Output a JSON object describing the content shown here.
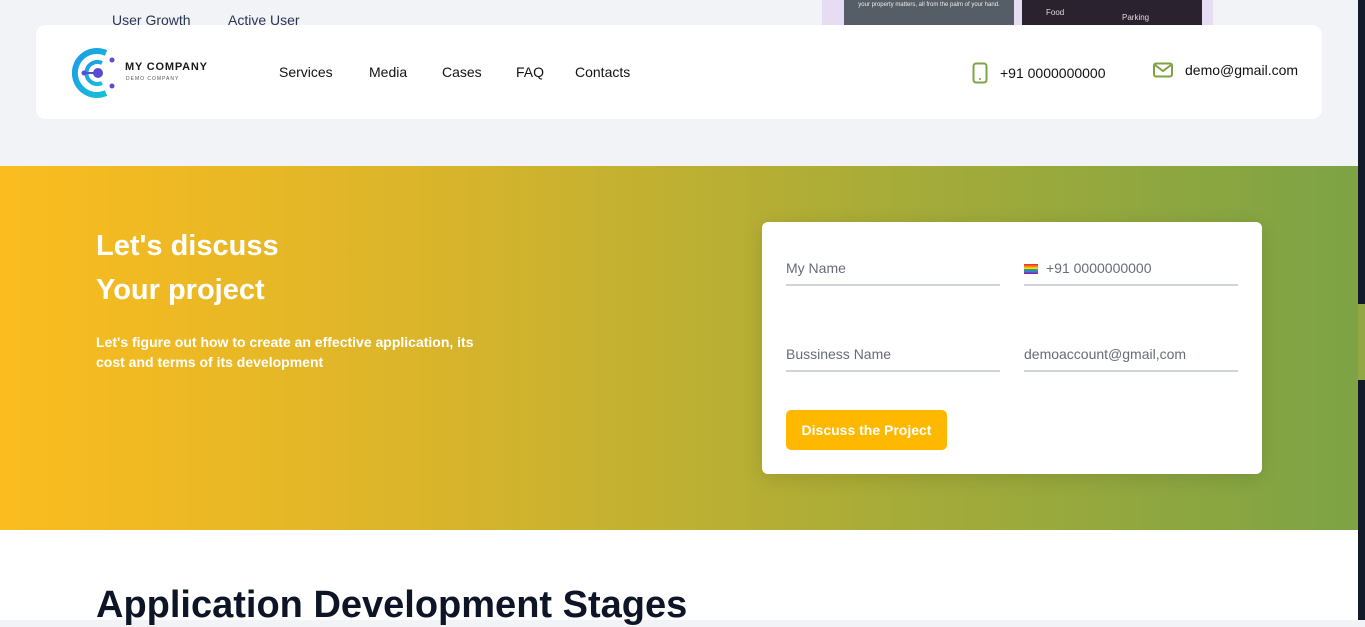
{
  "top_partial": {
    "tabs": [
      "User Growth",
      "Active User"
    ],
    "mockup_text": "your property matters, all from the palm of your hand.",
    "mockup_tiles": [
      "Food",
      "Parking"
    ]
  },
  "header": {
    "logo_title": "MY COMPANY",
    "logo_subtitle": "DEMO COMPANY",
    "nav": [
      "Services",
      "Media",
      "Cases",
      "FAQ",
      "Contacts"
    ],
    "phone": "+91 0000000000",
    "email": "demo@gmail.com",
    "icon_color": "#7ea344"
  },
  "hero": {
    "title_line1": "Let's discuss",
    "title_line2": "Your project",
    "description": "Let's figure out how to create an effective application, its cost and terms of its development"
  },
  "form": {
    "name_placeholder": "My Name",
    "phone_placeholder": "+91 0000000000",
    "business_placeholder": "Bussiness Name",
    "email_placeholder": "demoaccount@gmail,com",
    "submit_label": "Discuss the Project",
    "accent": "#ffb800"
  },
  "section": {
    "title": "Application Development Stages"
  }
}
